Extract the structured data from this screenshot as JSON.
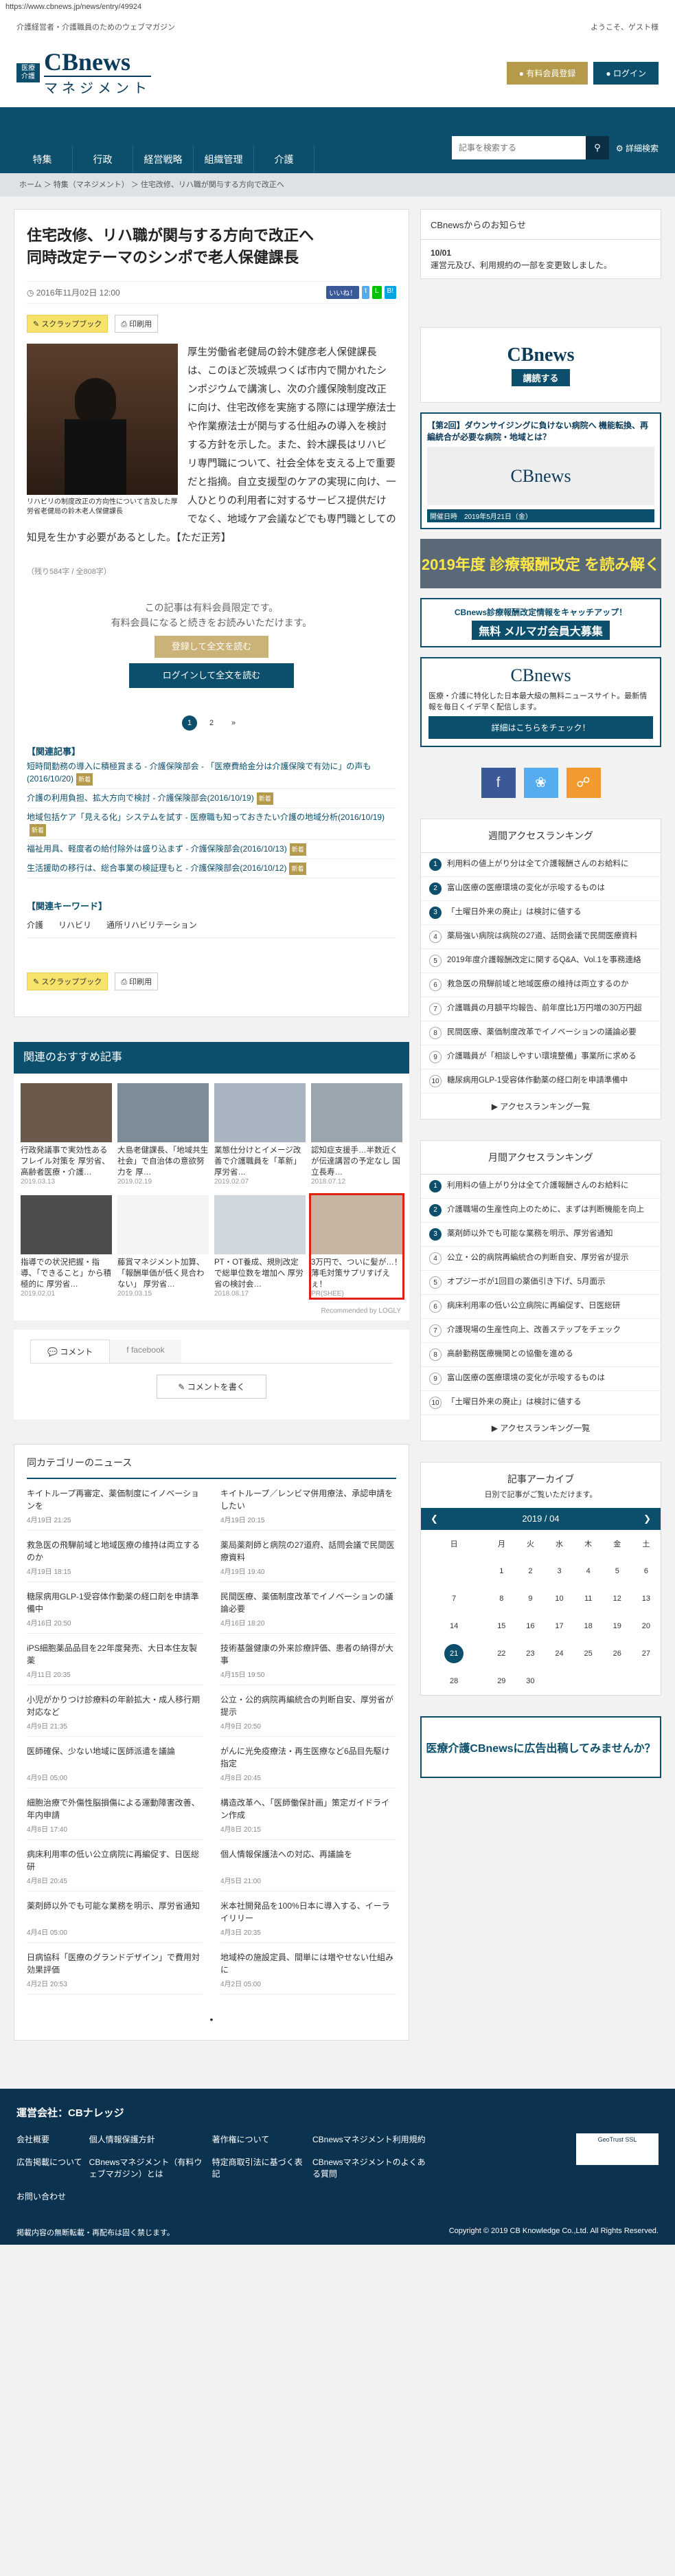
{
  "url": "https://www.cbnews.jp/news/entry/49924",
  "topbar": {
    "tagline": "介護経営者・介護職員のためのウェブマガジン",
    "welcome": "ようこそ、ゲスト様"
  },
  "logo": {
    "badge": "医療介護",
    "main": "CBnews",
    "sub": "マネジメント"
  },
  "header": {
    "register": "有料会員登録",
    "login": "ログイン"
  },
  "nav": [
    "特集",
    "行政",
    "経営戦略",
    "組織管理",
    "介護"
  ],
  "search": {
    "placeholder": "記事を検索する",
    "advanced": "詳細検索"
  },
  "crumb": "ホーム ＞ 特集（マネジメント） ＞ 住宅改修、リハ職が関与する方向で改正へ",
  "article": {
    "title": "住宅改修、リハ職が関与する方向で改正へ\n同時改定テーマのシンポで老人保健課長",
    "date": "2016年11月02日 12:00",
    "scrap": "スクラップブック",
    "print": "印刷用",
    "caption": "リハビリの制度改正の方向性について言及した厚労省老健局の鈴木老人保健課長",
    "body": "厚生労働省老健局の鈴木健彦老人保健課長は、このほど茨城県つくば市内で開かれたシンポジウムで講演し、次の介護保険制度改正に向け、住宅改修を実施する際には理学療法士や作業療法士が関与する仕組みの導入を検討する方針を示した。また、鈴木課長はリハビリ専門職について、社会全体を支える上で重要だと指摘。自立支援型のケアの実現に向け、一人ひとりの利用者に対するサービス提供だけでなく、地域ケア会議などでも専門職としての知見を生かす必要があるとした。【ただ正芳】",
    "count": "（残り584字 / 全808字）",
    "locked1": "この記事は有料会員限定です。",
    "locked2": "有料会員になると続きをお読みいただけます。",
    "btn_register": "登録して全文を読む",
    "btn_login": "ログインして全文を読む",
    "pages": [
      "1",
      "2",
      "»"
    ],
    "related_h": "【関連記事】",
    "related": [
      "短時間勤務の導入に積極賞まる - 介護保険部会 - 「医療費給金分は介護保険で有効に」の声も(2016/10/20)",
      "介護の利用負担、拡大方向で検討 - 介護保険部会(2016/10/19)",
      "地域包括ケア「見える化」システムを試す - 医療職も知っておきたい介護の地域分析(2016/10/19)",
      "福祉用具、軽度者の給付除外は盛り込まず - 介護保険部会(2016/10/13)",
      "生活援助の移行は、総合事業の検証理もと - 介護保険部会(2016/10/12)"
    ],
    "new_badge": "新着",
    "kw_h": "【関連キーワード】",
    "keywords": [
      "介護",
      "リハビリ",
      "通所リハビリテーション"
    ]
  },
  "reco": {
    "heading": "関連のおすすめ記事",
    "items": [
      {
        "t": "行政発議事で実効性あるフレイル対策を 厚労省、高齢者医療・介護…",
        "d": "2019.03.13"
      },
      {
        "t": "大島老健課長、「地域共生社会」で自治体の意欲努力を 厚…",
        "d": "2019.02.19"
      },
      {
        "t": "業態仕分けとイメージ改善で介護職員を「革新」 厚労省…",
        "d": "2019.02.07"
      },
      {
        "t": "認知症支援手…半数近くが伝達講習の予定なし 国立長寿…",
        "d": "2018.07.12"
      },
      {
        "t": "指導での状況把握・指導、「できること」から積極的に 厚労省…",
        "d": "2019.02.01"
      },
      {
        "t": "藤賞マネジメント加算、「報酬単価が低く見合わない」 厚労省…",
        "d": "2019.03.15"
      },
      {
        "t": "PT・OT養成、規則改定で総単位数を増加へ 厚労省の検討会…",
        "d": "2018.08.17"
      },
      {
        "t": "3万円で、ついに髪が…！薄毛対策サプリすげえぇ！",
        "d": "PR(SHEE)"
      }
    ],
    "powered": "Recommended by LOGLY"
  },
  "comments": {
    "tab1": "コメント",
    "tab2": "facebook",
    "write": "コメントを書く"
  },
  "category": {
    "heading": "同カテゴリーのニュース",
    "items": [
      {
        "t": "キイトループ再審定、薬価制度にイノベーションを",
        "d": "4月19日 21:25"
      },
      {
        "t": "キイトループ／レンビマ併用療法、承認申請をしたい",
        "d": "4月19日 20:15"
      },
      {
        "t": "救急医の飛騨前域と地域医療の維持は両立するのか",
        "d": "4月19日 18:15"
      },
      {
        "t": "薬局薬剤師と病院の27道府、話問会議で民間医療資料",
        "d": "4月19日 19:40"
      },
      {
        "t": "糖尿病用GLP-1受容体作動薬の経口剤を申請準備中",
        "d": "4月16日 20:50"
      },
      {
        "t": "民間医療、薬価制度改革でイノベーションの議論必要",
        "d": "4月16日 18:20"
      },
      {
        "t": "iPS細胞薬品品目を22年度発売、大日本住友製薬",
        "d": "4月11日 20:35"
      },
      {
        "t": "技術基盤健康の外来診療評価、患者の納得が大事",
        "d": "4月15日 19:50"
      },
      {
        "t": "小児がかりつけ診療料の年齢拡大・成人移行期対応など",
        "d": "4月9日 21:35"
      },
      {
        "t": "公立・公的病院再編統合の判断自安、厚労省が提示",
        "d": "4月9日 20:50"
      },
      {
        "t": "医師確保、少ない地域に医師派遣を議論",
        "d": "4月9日 05:00"
      },
      {
        "t": "がんに光免疫療法・再生医療など6品目先駆け指定",
        "d": "4月8日 20:45"
      },
      {
        "t": "細胞治療で外傷性脳損傷による運動障害改善、年内申請",
        "d": "4月8日 17:40"
      },
      {
        "t": "構造改革へ、「医師働保計画」策定ガイドライン作成",
        "d": "4月8日 20:15"
      },
      {
        "t": "病床利用率の低い公立病院に再編促す、日医総研",
        "d": "4月8日 20:45"
      },
      {
        "t": "個人情報保護法への対応、再議論を",
        "d": "4月5日 21:00"
      },
      {
        "t": "薬剤師以外でも可能な業務を明示、厚労省通知",
        "d": "4月4日 05:00"
      },
      {
        "t": "米本社開発品を100%日本に導入する、イーライリリー",
        "d": "4月3日 20:35"
      },
      {
        "t": "日病協科「医療のグランドデザイン」で費用対効果評価",
        "d": "4月2日 20:53"
      },
      {
        "t": "地域枠の施設定員、間単には増やせない仕組みに",
        "d": "4月2日 05:00"
      }
    ]
  },
  "side": {
    "notice_h": "CBnewsからのお知らせ",
    "notice_date": "10/01",
    "notice_text": "運営元及び、利用規約の一部を変更致しました。",
    "ad1": "講読する",
    "ad2": "【第2回】ダウンサイジングに負けない病院へ 機能転換、再編統合が必要な病院・地域とは？",
    "ad2_date": "開催日時　2019年5月21日（金）",
    "ad3": "2019年度 診療報酬改定 を読み解く",
    "ad4_1": "CBnews診療報酬改定情報をキャッチアップ！",
    "ad4_2": "無料 メルマガ会員大募集",
    "info_text": "医療・介護に特化した日本最大級の無料ニュースサイト。最新情報を毎日くイデ早く配信します。",
    "info_btn": "詳細はこちらをチェック！",
    "rank_weekly": "週間アクセスランキング",
    "weekly": [
      "利用料の値上がり分は全て介護報酬さんのお給料に",
      "富山医療の医療環境の変化が示唆するものは",
      "「土曜日外来の廃止」は検討に値する",
      "薬局強い病院は病院の27道、話問会議で民間医療資料",
      "2019年度介護報酬改定に関するQ&A、Vol.1を事務連絡",
      "救急医の飛騨前域と地域医療の維持は両立するのか",
      "介護職員の月額平均報告、前年度比1万円増の30万円超",
      "民間医療、薬価制度改革でイノベーションの議論必要",
      "介護職員が「相談しやすい環境整備」事業所に求める",
      "糖尿病用GLP-1受容体作動薬の経口剤を申請準備中"
    ],
    "rank_more": "アクセスランキング一覧",
    "rank_monthly": "月間アクセスランキング",
    "monthly": [
      "利用料の値上がり分は全て介護報酬さんのお給料に",
      "介護職場の生産性向上のために、まずは判断機能を向上",
      "薬剤師以外でも可能な業務を明示、厚労省通知",
      "公立・公的病院再編統合の判断自安、厚労省が提示",
      "オプジーボが1回目の薬価引き下げ、5月面示",
      "病床利用率の低い公立病院に再編促す、日医総研",
      "介護現場の生産性向上、改善ステップをチェック",
      "高齢勤務医療機関との協働を進める",
      "富山医療の医療環境の変化が示唆するものは",
      "「土曜日外来の廃止」は検討に値する"
    ],
    "archive_h": "記事アーカイブ",
    "archive_sub": "日別で記事がご覧いただけます。",
    "cal_month": "2019 / 04",
    "cal_days": [
      "日",
      "月",
      "火",
      "水",
      "木",
      "金",
      "土"
    ],
    "ad5": "医療介護CBnewsに広告出稿してみませんか？"
  },
  "footer": {
    "heading": "運営会社：CBナレッジ",
    "links": [
      "会社概要",
      "個人情報保護方針",
      "著作権について",
      "CBnewsマネジメント利用規約",
      "広告掲載について",
      "CBnewsマネジメント（有料ウェブマガジン）とは",
      "特定商取引法に基づく表記",
      "CBnewsマネジメントのよくある質問",
      "お問い合わせ"
    ],
    "left": "掲載内容の無断転載・再配布は固く禁じます。",
    "right": "Copyright © 2019 CB Knowledge Co.,Ltd. All Rights Reserved.",
    "geo": "GeoTrust SSL"
  },
  "colors": {
    "navy": "#0b4f6c",
    "gold": "#b49a4a"
  }
}
